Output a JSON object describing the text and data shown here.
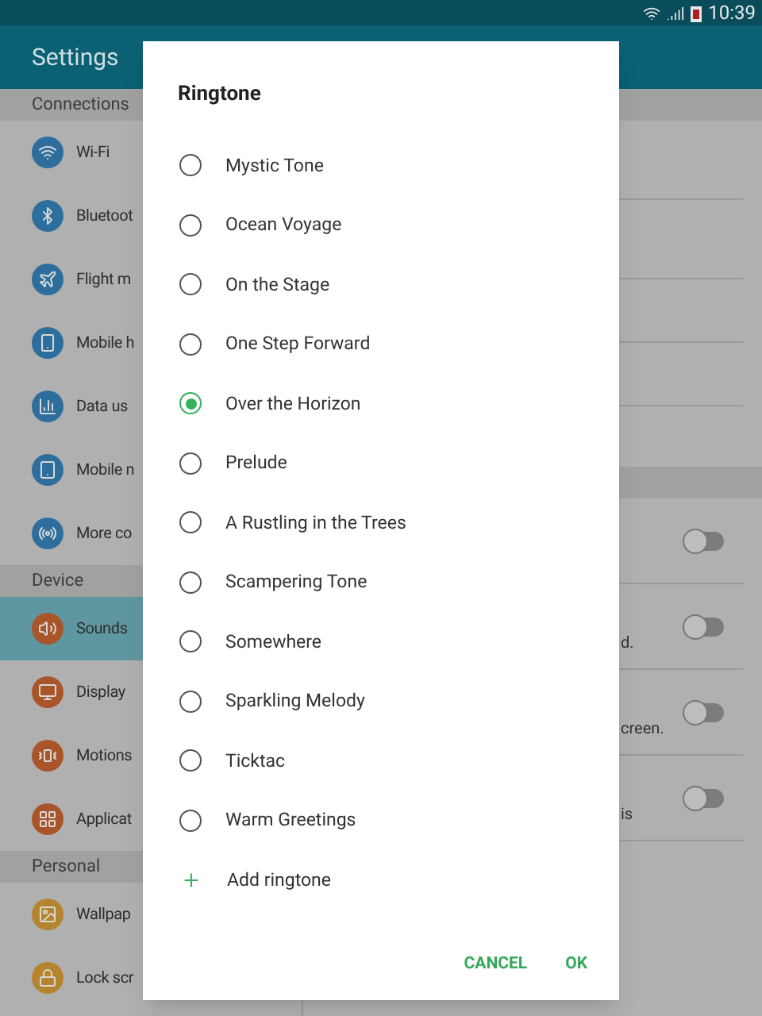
{
  "status_bar": {
    "time": "10:39"
  },
  "app_bar": {
    "title": "Settings"
  },
  "sidebar": {
    "sections": [
      {
        "header": "Connections",
        "items": [
          {
            "label": "Wi-Fi",
            "selected": false,
            "color": "#2d6e9c"
          },
          {
            "label": "Bluetoot",
            "selected": false,
            "color": "#2d6e9c"
          },
          {
            "label": "Flight m",
            "selected": false,
            "color": "#2d6e9c"
          },
          {
            "label": "Mobile h",
            "selected": false,
            "color": "#2d6e9c"
          },
          {
            "label": "Data us",
            "selected": false,
            "color": "#2d6e9c"
          },
          {
            "label": "Mobile n",
            "selected": false,
            "color": "#2d6e9c"
          },
          {
            "label": "More co",
            "selected": false,
            "color": "#2d6e9c"
          }
        ]
      },
      {
        "header": "Device",
        "items": [
          {
            "label": "Sounds",
            "selected": true,
            "color": "#a9552a"
          },
          {
            "label": "Display",
            "selected": false,
            "color": "#a9552a"
          },
          {
            "label": "Motions",
            "selected": false,
            "color": "#a9552a"
          },
          {
            "label": "Applicat",
            "selected": false,
            "color": "#a9552a"
          }
        ]
      },
      {
        "header": "Personal",
        "items": [
          {
            "label": "Wallpap",
            "selected": false,
            "color": "#b5842e"
          },
          {
            "label": "Lock scr",
            "selected": false,
            "color": "#b5842e"
          }
        ]
      }
    ]
  },
  "right_panel": {
    "toggle_rows": [
      {
        "text_fragment": "",
        "on": false
      },
      {
        "text_fragment": "d.",
        "on": false
      },
      {
        "text_fragment": "creen.",
        "on": false
      },
      {
        "text_fragment": "is",
        "on": false
      }
    ]
  },
  "dialog": {
    "title": "Ringtone",
    "options": [
      {
        "label": "Mystic Tone",
        "selected": false
      },
      {
        "label": "Ocean Voyage",
        "selected": false
      },
      {
        "label": "On the Stage",
        "selected": false
      },
      {
        "label": "One Step Forward",
        "selected": false
      },
      {
        "label": "Over the Horizon",
        "selected": true
      },
      {
        "label": "Prelude",
        "selected": false
      },
      {
        "label": "A Rustling in the Trees",
        "selected": false
      },
      {
        "label": "Scampering Tone",
        "selected": false
      },
      {
        "label": "Somewhere",
        "selected": false
      },
      {
        "label": "Sparkling Melody",
        "selected": false
      },
      {
        "label": "Ticktac",
        "selected": false
      },
      {
        "label": "Warm Greetings",
        "selected": false
      }
    ],
    "add_label": "Add ringtone",
    "buttons": [
      "CANCEL",
      "OK"
    ]
  }
}
